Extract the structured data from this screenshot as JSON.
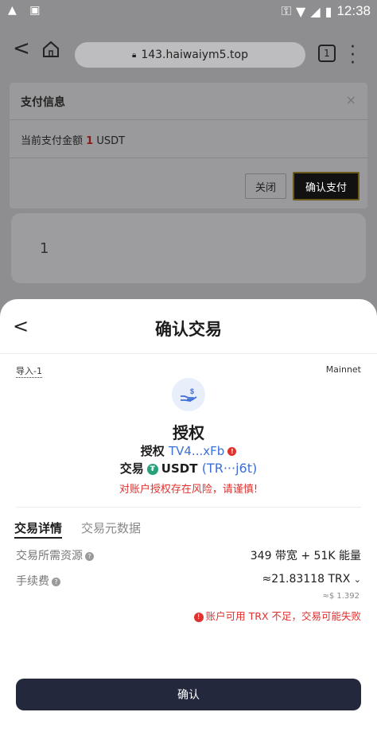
{
  "status_bar": {
    "time": "12:38"
  },
  "browser": {
    "url": "143.haiwaiym5.top",
    "tab_count": "1"
  },
  "payment_dialog": {
    "title": "支付信息",
    "amount_prefix": "当前支付金额",
    "amount_value": "1",
    "amount_unit": "USDT",
    "close_label": "关闭",
    "confirm_label": "确认支付"
  },
  "background_card": {
    "value": "1"
  },
  "sheet": {
    "title": "确认交易",
    "import_label": "导入-1",
    "network_label": "Mainnet",
    "action_title": "授权",
    "auth_prefix": "授权",
    "auth_address": "TV4...xFb",
    "tx_prefix": "交易",
    "tx_token": "USDT",
    "tx_address": "(TR···j6t)",
    "risk_warning": "对账户授权存在风险，请谨慎!",
    "tabs": {
      "details": "交易详情",
      "metadata": "交易元数据"
    },
    "resources_label": "交易所需资源",
    "resources_value": "349 带宽 + 51K 能量",
    "fee_label": "手续费",
    "fee_value": "≈21.83118 TRX",
    "fee_usd": "≈$ 1.392",
    "fee_warning": "账户可用 TRX 不足，交易可能失败",
    "confirm_label": "确认"
  },
  "colors": {
    "accent": "#3d6fd6",
    "danger": "#e0312e",
    "button": "#23283d"
  }
}
